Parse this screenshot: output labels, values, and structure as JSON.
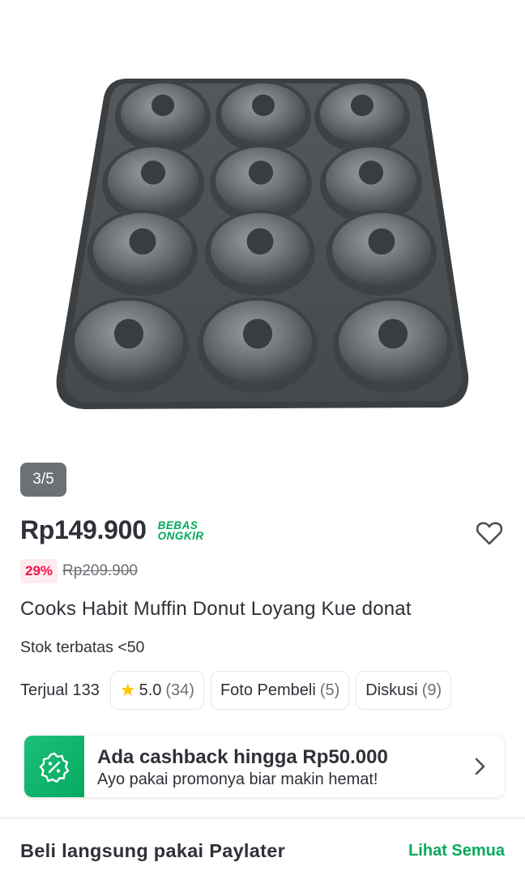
{
  "gallery": {
    "counter": "3/5"
  },
  "product": {
    "price": "Rp149.900",
    "shipping_badge_line1": "BEBAS",
    "shipping_badge_line2": "ONGKIR",
    "discount": "29%",
    "original_price": "Rp209.900",
    "title": "Cooks Habit Muffin Donut Loyang Kue donat",
    "stock": "Stok terbatas <50"
  },
  "stats": {
    "sold": "Terjual 133",
    "rating": "5.0",
    "rating_count": "(34)",
    "photos_label": "Foto Pembeli",
    "photos_count": "(5)",
    "discussion_label": "Diskusi",
    "discussion_count": "(9)"
  },
  "cashback": {
    "title": "Ada cashback hingga Rp50.000",
    "subtitle": "Ayo pakai promonya biar makin hemat!"
  },
  "paylater": {
    "title": "Beli langsung pakai Paylater",
    "link": "Lihat Semua"
  },
  "colors": {
    "brand_green": "#00aa5b",
    "discount_red": "#ef144a",
    "text": "#2e3137"
  },
  "icons": [
    "heart-icon",
    "star-icon",
    "discount-percent-icon",
    "chevron-right-icon"
  ]
}
